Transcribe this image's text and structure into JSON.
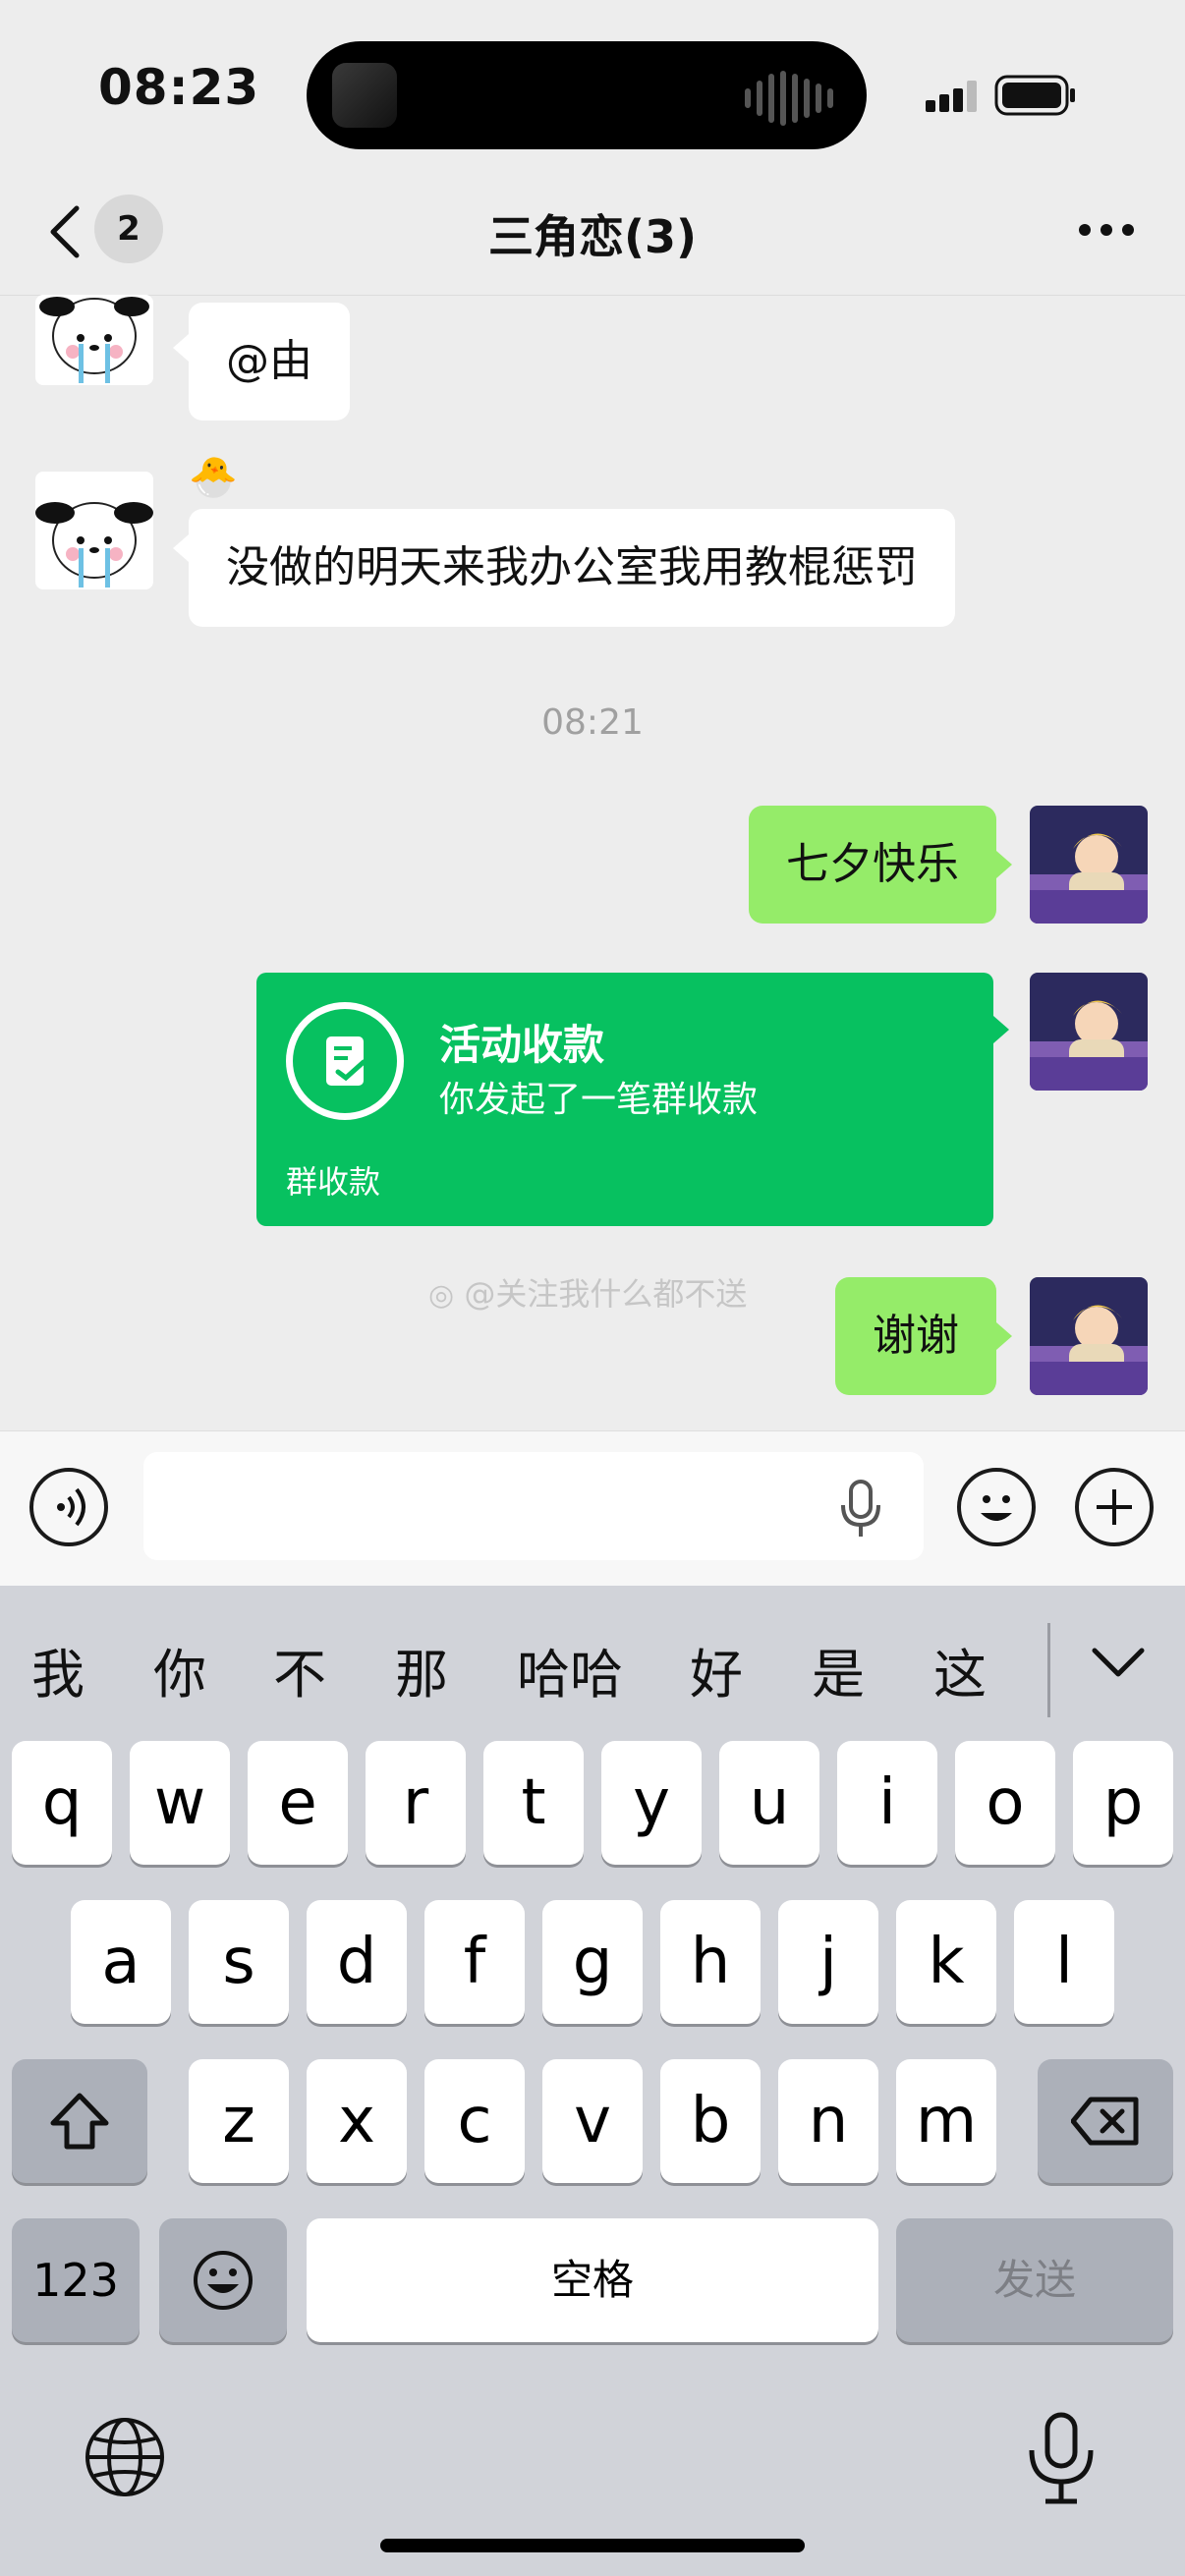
{
  "status": {
    "time": "08:23"
  },
  "nav": {
    "back_count": "2",
    "title": "三角恋(3)"
  },
  "messages": {
    "m1": {
      "text": "@由"
    },
    "m2": {
      "sticker": "🐣",
      "text": "没做的明天来我办公室我用教棍惩罚"
    },
    "timestamp": "08:21",
    "m3": {
      "text": "七夕快乐"
    },
    "payment": {
      "title": "活动收款",
      "subtitle": "你发起了一笔群收款",
      "footer": "群收款"
    },
    "m4": {
      "text": "谢谢"
    }
  },
  "watermark": "@关注我什么都不送",
  "input": {
    "placeholder": ""
  },
  "keyboard": {
    "candidates": [
      "我",
      "你",
      "不",
      "那",
      "哈哈",
      "好",
      "是",
      "这"
    ],
    "row1": [
      "q",
      "w",
      "e",
      "r",
      "t",
      "y",
      "u",
      "i",
      "o",
      "p"
    ],
    "row2": [
      "a",
      "s",
      "d",
      "f",
      "g",
      "h",
      "j",
      "k",
      "l"
    ],
    "row3": [
      "z",
      "x",
      "c",
      "v",
      "b",
      "n",
      "m"
    ],
    "numbers_label": "123",
    "space_label": "空格",
    "send_label": "发送"
  },
  "colors": {
    "bubble_green": "#95ec69",
    "pay_green": "#07c160",
    "keyboard_bg": "#d1d3d9"
  }
}
